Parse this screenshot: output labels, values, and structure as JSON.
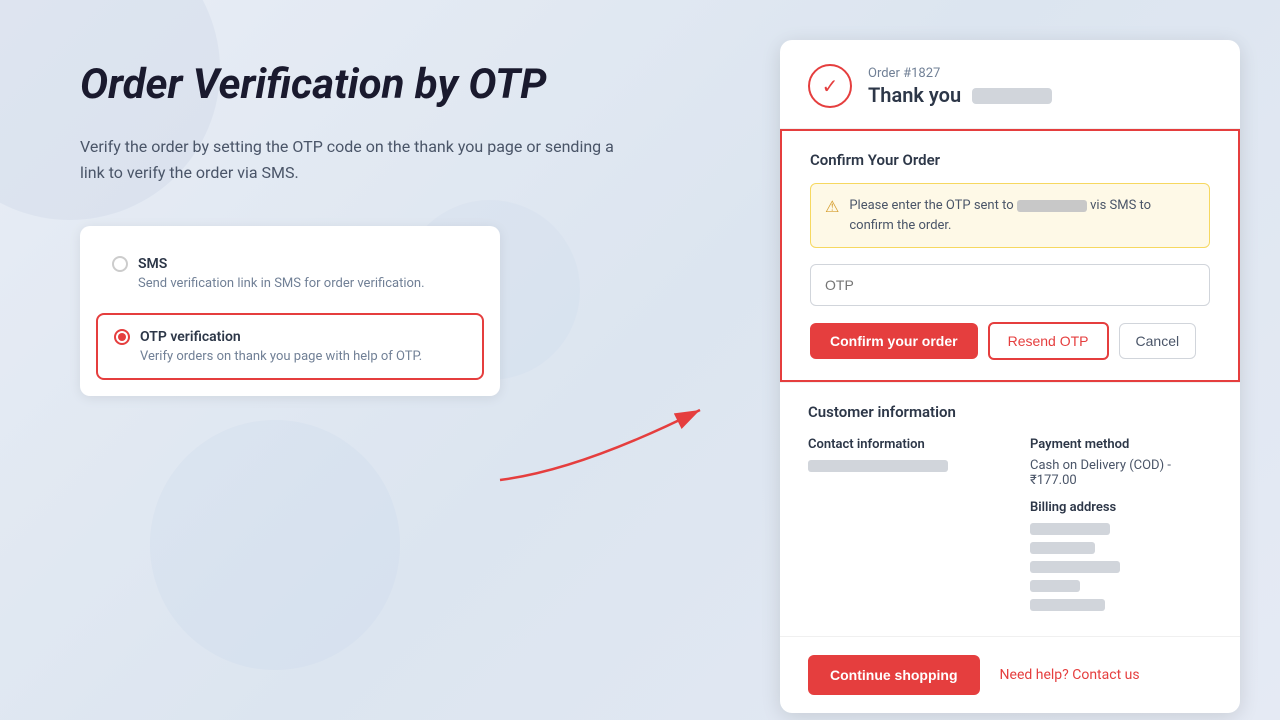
{
  "background": {
    "color": "#e8edf5"
  },
  "left": {
    "title": "Order Verification by OTP",
    "description": "Verify the order by setting the OTP code on the thank you page or sending a link to verify the order via SMS.",
    "options": [
      {
        "id": "sms",
        "title": "SMS",
        "description": "Send verification link in SMS for order verification.",
        "active": false
      },
      {
        "id": "otp",
        "title": "OTP verification",
        "description": "Verify orders on thank you page with help of OTP.",
        "active": true
      }
    ]
  },
  "right": {
    "order_number": "Order #1827",
    "thank_you_prefix": "Thank you",
    "confirm_section": {
      "title": "Confirm Your Order",
      "alert_text_prefix": "Please enter the OTP sent to",
      "alert_text_suffix": "vis SMS to confirm the order.",
      "otp_placeholder": "OTP",
      "buttons": {
        "confirm": "Confirm your order",
        "resend": "Resend OTP",
        "cancel": "Cancel"
      }
    },
    "customer_section": {
      "title": "Customer information",
      "contact_label": "Contact information",
      "payment_label": "Payment method",
      "payment_value": "Cash on Delivery (COD) - ₹177.00",
      "billing_label": "Billing address"
    },
    "bottom": {
      "continue_label": "Continue shopping",
      "help_label": "Need help? Contact us"
    }
  }
}
